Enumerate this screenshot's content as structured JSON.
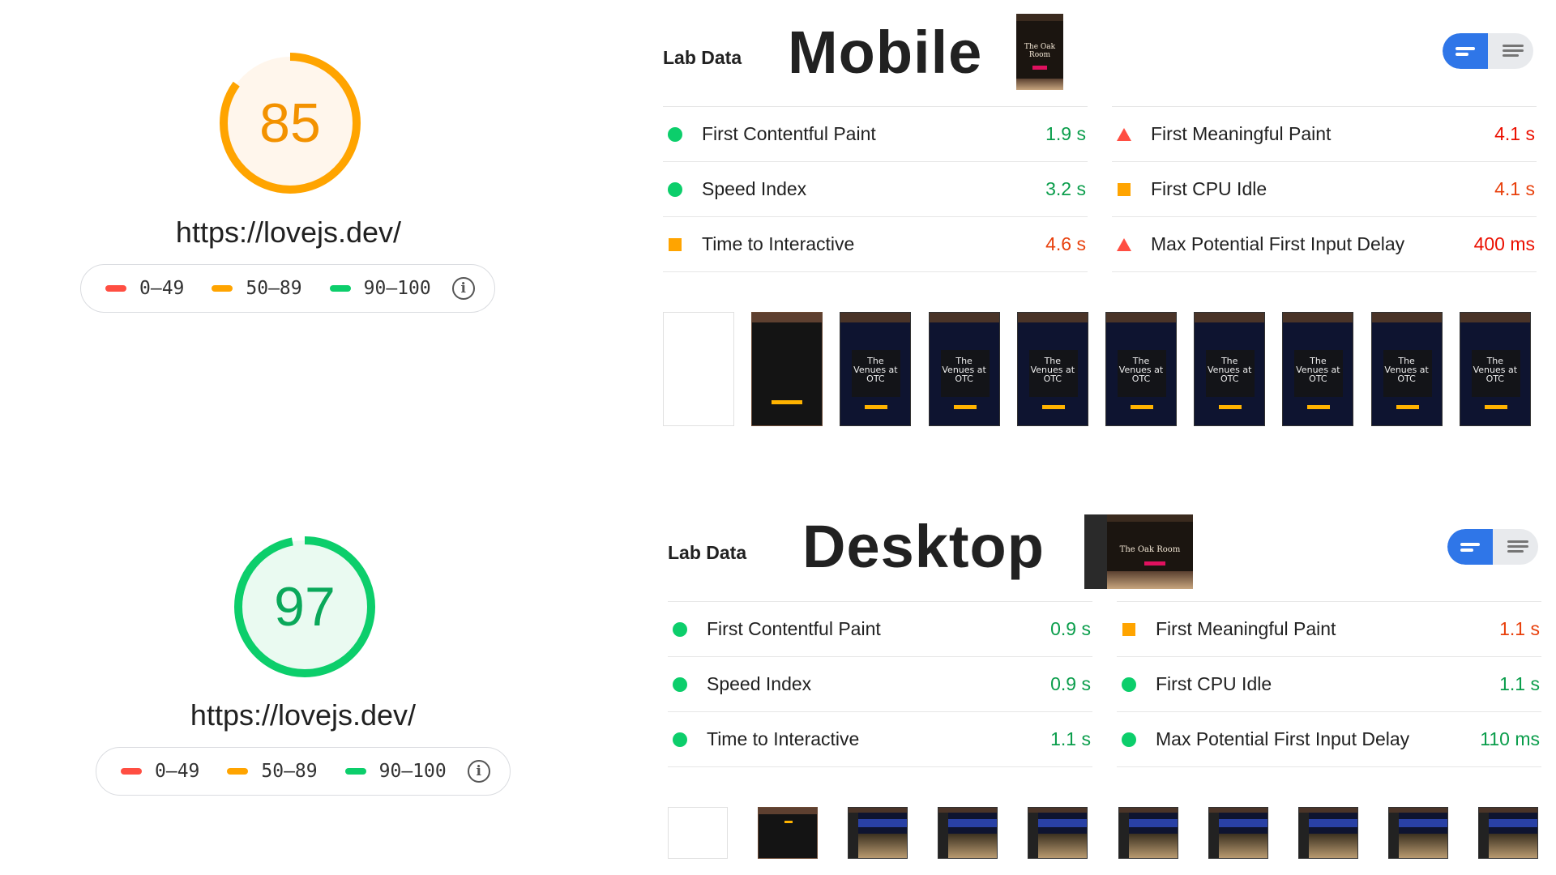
{
  "legend": {
    "ranges": [
      {
        "label": "0–49",
        "color": "#ff4e42"
      },
      {
        "label": "50–89",
        "color": "#ffa400"
      },
      {
        "label": "90–100",
        "color": "#0cce6b"
      }
    ],
    "info_icon": "info-icon"
  },
  "mobile": {
    "score": {
      "value": "85",
      "fraction": 0.85,
      "color": "#ffa400",
      "text_color": "#f39200",
      "bg": "#fff6ec"
    },
    "url": "https://lovejs.dev/",
    "lab_title": "Lab Data",
    "device_title": "Mobile",
    "hero": {
      "line1": "The Oak",
      "line2": "Room"
    },
    "metrics_left": [
      {
        "label": "First Contentful Paint",
        "value": "1.9 s",
        "status": "pass"
      },
      {
        "label": "Speed Index",
        "value": "3.2 s",
        "status": "pass"
      },
      {
        "label": "Time to Interactive",
        "value": "4.6 s",
        "status": "average"
      }
    ],
    "metrics_right": [
      {
        "label": "First Meaningful Paint",
        "value": "4.1 s",
        "status": "fail"
      },
      {
        "label": "First CPU Idle",
        "value": "4.1 s",
        "status": "average"
      },
      {
        "label": "Max Potential First Input Delay",
        "value": "400 ms",
        "status": "fail"
      }
    ],
    "frame_text": {
      "line1": "The",
      "line2": "Venues at",
      "line3": "OTC"
    }
  },
  "desktop": {
    "score": {
      "value": "97",
      "fraction": 0.97,
      "color": "#0cce6b",
      "text_color": "#0aa85a",
      "bg": "#eafaf1"
    },
    "url": "https://lovejs.dev/",
    "lab_title": "Lab Data",
    "device_title": "Desktop",
    "hero": {
      "line1": "The Oak Room"
    },
    "metrics_left": [
      {
        "label": "First Contentful Paint",
        "value": "0.9 s",
        "status": "pass"
      },
      {
        "label": "Speed Index",
        "value": "0.9 s",
        "status": "pass"
      },
      {
        "label": "Time to Interactive",
        "value": "1.1 s",
        "status": "pass"
      }
    ],
    "metrics_right": [
      {
        "label": "First Meaningful Paint",
        "value": "1.1 s",
        "status": "average"
      },
      {
        "label": "First CPU Idle",
        "value": "1.1 s",
        "status": "pass"
      },
      {
        "label": "Max Potential First Input Delay",
        "value": "110 ms",
        "status": "pass"
      }
    ]
  },
  "status_colors": {
    "pass": "#0cce6b",
    "average": "#ffa400",
    "fail": "#ff4e42"
  },
  "value_colors": {
    "pass": "#0a9d4b",
    "average": "#e8400c",
    "fail": "#eb0f00"
  }
}
